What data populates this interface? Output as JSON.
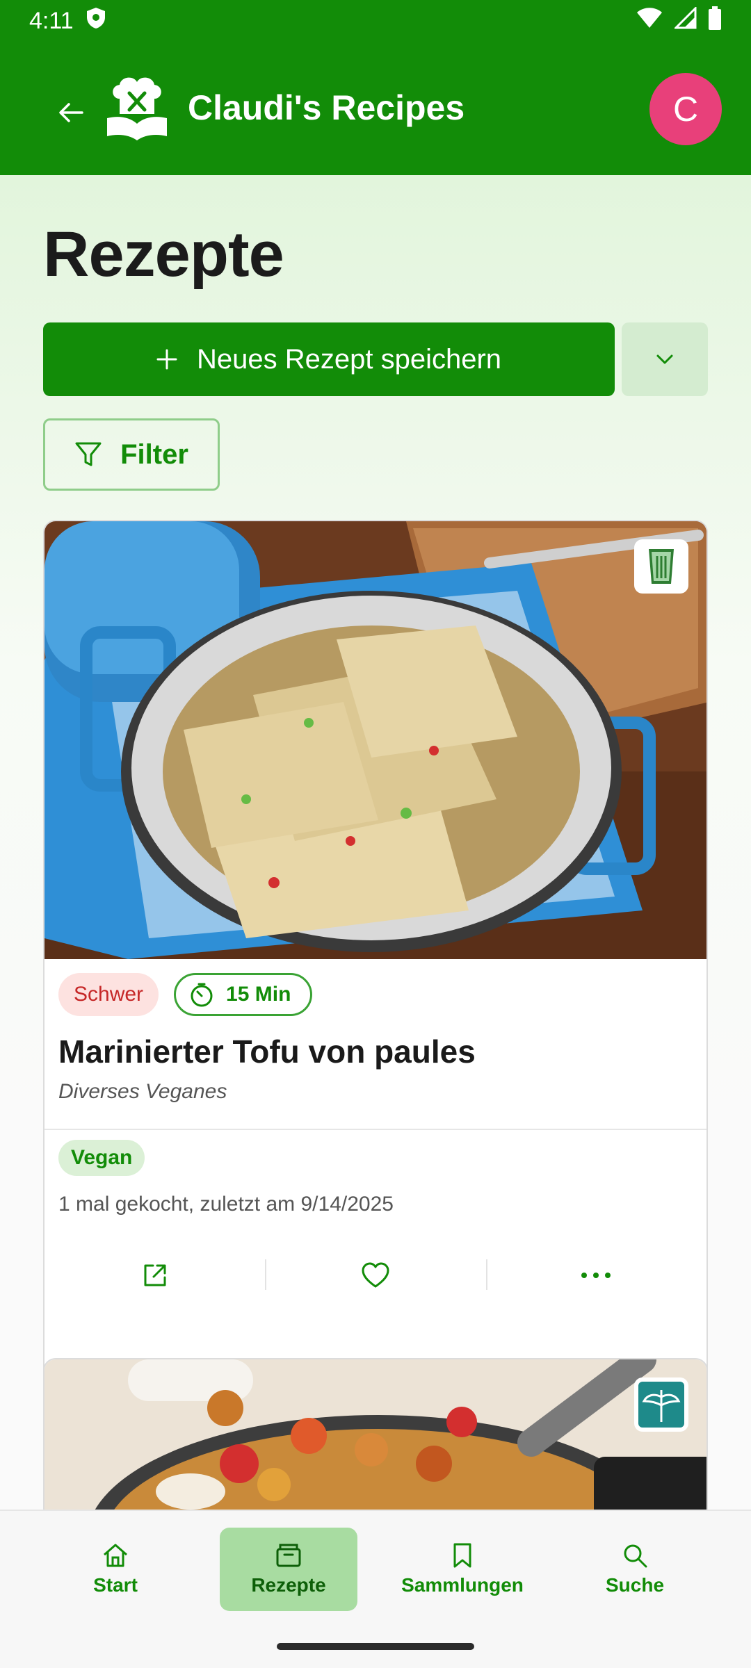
{
  "status_bar": {
    "time": "4:11",
    "icons": [
      "shield-icon",
      "wifi-icon",
      "signal-icon",
      "battery-icon"
    ]
  },
  "app_bar": {
    "title": "Claudi's Recipes",
    "avatar_initial": "C",
    "logo_icon": "chef-book-icon",
    "back_icon": "arrow-left-icon"
  },
  "page": {
    "title": "Rezepte"
  },
  "actions": {
    "new_recipe_label": "Neues Rezept speichern",
    "filter_label": "Filter"
  },
  "recipes": [
    {
      "difficulty": "Schwer",
      "time": "15 Min",
      "title": "Marinierter Tofu von paules",
      "category": "Diverses Veganes",
      "tag": "Vegan",
      "cooked_info": "1 mal gekocht, zuletzt am 9/14/2025",
      "source_icon": "chefs-hat-icon"
    },
    {
      "source_icon": "sanctuary-icon"
    }
  ],
  "bottom_nav": {
    "items": [
      {
        "label": "Start",
        "icon": "home-icon"
      },
      {
        "label": "Rezepte",
        "icon": "recipe-box-icon",
        "active": true
      },
      {
        "label": "Sammlungen",
        "icon": "bookmark-icon"
      },
      {
        "label": "Suche",
        "icon": "search-icon"
      }
    ]
  },
  "colors": {
    "primary": "#128c08",
    "avatar": "#e8407a",
    "difficulty_bg": "#fde2e0",
    "difficulty_text": "#c62828",
    "nav_active": "#a8dca1"
  }
}
